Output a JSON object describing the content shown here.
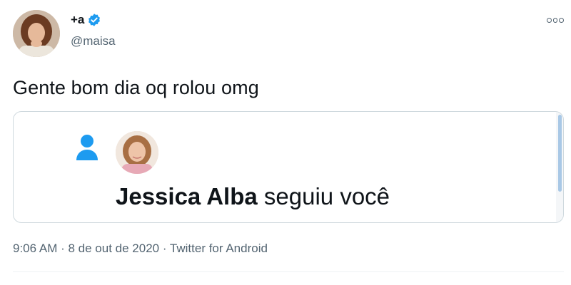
{
  "author": {
    "display_name": "+a",
    "handle": "@maisa",
    "verified": true
  },
  "tweet": {
    "text": "Gente bom dia oq rolou omg"
  },
  "media": {
    "follower_name": "Jessica Alba",
    "action_text": " seguiu você"
  },
  "meta": {
    "time": "9:06 AM",
    "separator1": " · ",
    "date": "8 de out de 2020",
    "separator2": " · ",
    "source": "Twitter for Android"
  },
  "icons": {
    "verified": "verified-badge-icon",
    "more": "more-options-icon",
    "person": "person-icon"
  },
  "colors": {
    "accent": "#1d9bf0",
    "text_primary": "#0f1419",
    "text_secondary": "#536471",
    "border": "#cfd9de"
  }
}
